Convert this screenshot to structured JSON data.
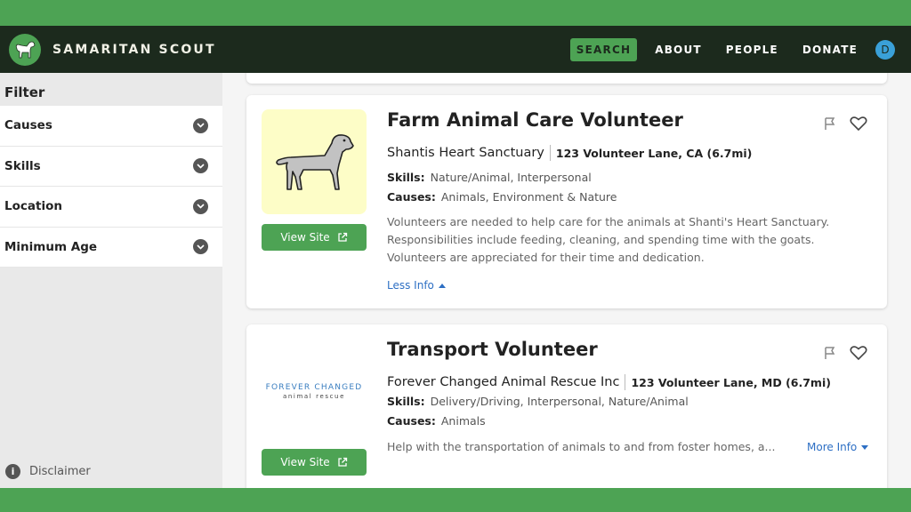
{
  "header": {
    "brand": "SAMARITAN SCOUT",
    "logo_icon": "dog-logo-icon",
    "nav": [
      {
        "label": "SEARCH",
        "active": true
      },
      {
        "label": "ABOUT",
        "active": false
      },
      {
        "label": "PEOPLE",
        "active": false
      },
      {
        "label": "DONATE",
        "active": false
      }
    ],
    "user_initial": "D"
  },
  "sidebar": {
    "title": "Filter",
    "filters": [
      {
        "label": "Causes"
      },
      {
        "label": "Skills"
      },
      {
        "label": "Location"
      },
      {
        "label": "Minimum Age"
      }
    ],
    "disclaimer": "Disclaimer"
  },
  "listings": [
    {
      "title": "Farm Animal Care Volunteer",
      "org": "Shantis Heart Sanctuary",
      "location": "123 Volunteer Lane, CA (6.7mi)",
      "skills_label": "Skills:",
      "skills": "Nature/Animal, Interpersonal",
      "causes_label": "Causes:",
      "causes": "Animals, Environment & Nature",
      "description": "Volunteers are needed to help care for the animals at Shanti's Heart Sanctuary. Responsibilities include feeding, cleaning, and spending time with the goats. Volunteers are appreciated for their time and dedication.",
      "view_site_label": "View Site",
      "toggle_label": "Less Info"
    },
    {
      "title": "Transport Volunteer",
      "org": "Forever Changed Animal Rescue Inc",
      "location": "123 Volunteer Lane, MD (6.7mi)",
      "skills_label": "Skills:",
      "skills": "Delivery/Driving, Interpersonal, Nature/Animal",
      "causes_label": "Causes:",
      "causes": "Animals",
      "description": "Help with the transportation of animals to and from foster homes, a...",
      "logo_text": "FOREVER CHANGED",
      "logo_subtext": "animal rescue",
      "view_site_label": "View Site",
      "toggle_label": "More Info"
    }
  ],
  "colors": {
    "brand_green": "#4da354",
    "header_dark": "#1c2a1d",
    "link_blue": "#2d6fc4",
    "thumb_yellow": "#fdfdc7",
    "avatar_blue": "#3aa0d8"
  }
}
